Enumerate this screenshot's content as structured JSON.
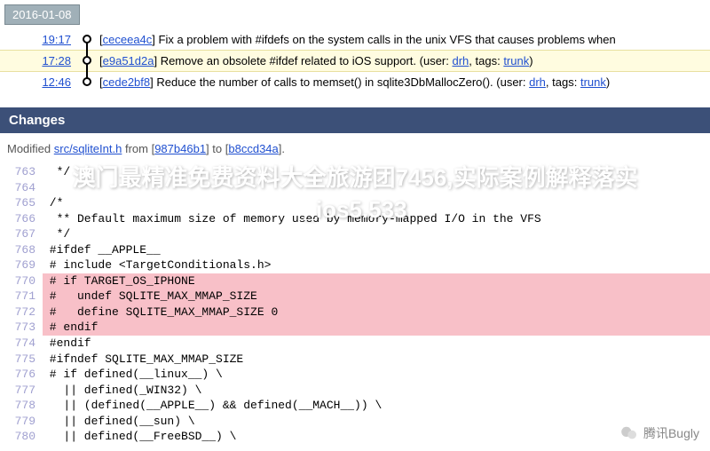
{
  "date": "2016-01-08",
  "timeline": [
    {
      "time": "19:17",
      "hash": "ceceea4c",
      "msg": "Fix a problem with #ifdefs on the system calls in the unix VFS that causes problems when",
      "hl": false,
      "meta": null
    },
    {
      "time": "17:28",
      "hash": "e9a51d2a",
      "msg": "Remove an obsolete #ifdef related to iOS support. (user: ",
      "hl": true,
      "meta": {
        "user": "drh",
        "tags": "trunk"
      }
    },
    {
      "time": "12:46",
      "hash": "cede2bf8",
      "msg": "Reduce the number of calls to memset() in sqlite3DbMallocZero(). (user: ",
      "hl": false,
      "meta": {
        "user": "drh",
        "tags": "trunk"
      }
    }
  ],
  "changes_label": "Changes",
  "modified": {
    "prefix": "Modified ",
    "file": "src/sqliteInt.h",
    "mid": " from ",
    "from": "987b46b1",
    "to_prefix": " to ",
    "to": "b8ccd34a",
    "suffix": "]."
  },
  "code": [
    {
      "n": 763,
      "t": "  */",
      "cls": ""
    },
    {
      "n": 764,
      "t": "",
      "cls": ""
    },
    {
      "n": 765,
      "t": " /*",
      "cls": ""
    },
    {
      "n": 766,
      "t": "  ** Default maximum size of memory used by memory-mapped I/O in the VFS",
      "cls": ""
    },
    {
      "n": 767,
      "t": "  */",
      "cls": ""
    },
    {
      "n": 768,
      "t": " #ifdef __APPLE__",
      "cls": ""
    },
    {
      "n": 769,
      "t": " # include <TargetConditionals.h>",
      "cls": ""
    },
    {
      "n": 770,
      "t": " # if TARGET_OS_IPHONE",
      "cls": "del"
    },
    {
      "n": 771,
      "t": " #   undef SQLITE_MAX_MMAP_SIZE",
      "cls": "del"
    },
    {
      "n": 772,
      "t": " #   define SQLITE_MAX_MMAP_SIZE 0",
      "cls": "del"
    },
    {
      "n": 773,
      "t": " # endif",
      "cls": "del"
    },
    {
      "n": 774,
      "t": " #endif",
      "cls": ""
    },
    {
      "n": 775,
      "t": " #ifndef SQLITE_MAX_MMAP_SIZE",
      "cls": ""
    },
    {
      "n": 776,
      "t": " # if defined(__linux__) \\",
      "cls": ""
    },
    {
      "n": 777,
      "t": "   || defined(_WIN32) \\",
      "cls": ""
    },
    {
      "n": 778,
      "t": "   || (defined(__APPLE__) && defined(__MACH__)) \\",
      "cls": ""
    },
    {
      "n": 779,
      "t": "   || defined(__sun) \\",
      "cls": ""
    },
    {
      "n": 780,
      "t": "   || defined(__FreeBSD__) \\",
      "cls": ""
    }
  ],
  "overlay": "澳门最精准免费资料大全旅游团7456,实际案例解释落实_ios5.533",
  "watermark": "腾讯Bugly"
}
